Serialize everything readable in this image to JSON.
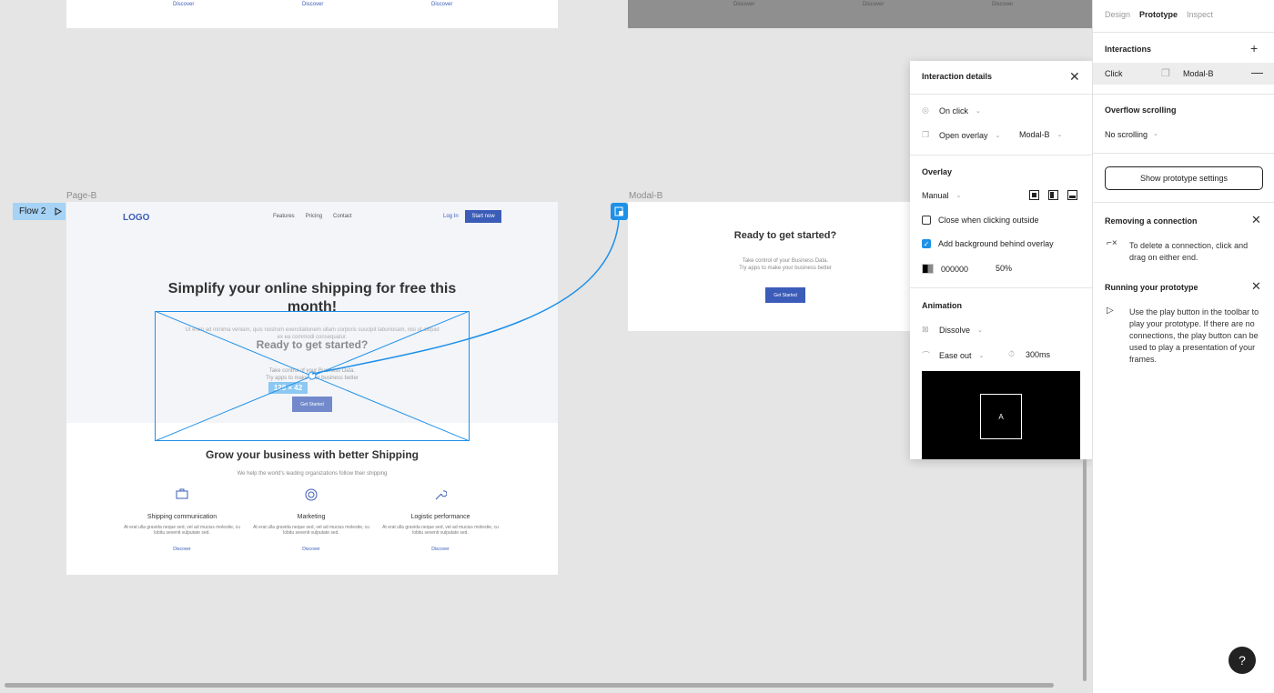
{
  "canvas": {
    "top_frames": {
      "left_discover": [
        "Discover",
        "Discover",
        "Discover"
      ],
      "right_discover": [
        "Discover",
        "Discover",
        "Discover"
      ]
    },
    "flow_tag": "Flow 2",
    "page_label": "Page-B",
    "modal_label": "Modal-B",
    "page": {
      "logo": "LOGO",
      "nav": [
        "Features",
        "Pricing",
        "Contact"
      ],
      "login": "Log In",
      "start_now": "Start now",
      "hero_title": "Simplify your online shipping for free this month!",
      "hero_sub": "Ut enim ad minima veniam, quis nostrum exercitationem ullam corporis suscipit laboriosam, nisi ut aliquid ex ea commodi consequatur.",
      "grow_title": "Grow your business with better Shipping",
      "grow_sub": "We help the world's leading organizations follow their shipping",
      "features": [
        {
          "icon": "briefcase-icon",
          "title": "Shipping communication",
          "desc": "At erat ulla gravida neque sed, vel ad mucius molestie, cu lobitu sevenit vulputate sed.",
          "link": "Discover"
        },
        {
          "icon": "lifebuoy-icon",
          "title": "Marketing",
          "desc": "At erat ulla gravida neque sed, vel ad mucius molestie, cu lobitu sevenit vulputate sed.",
          "link": "Discover"
        },
        {
          "icon": "wrench-icon",
          "title": "Logistic performance",
          "desc": "At erat ulla gravida neque sed, vel ad mucius molestie, cu lobitu sevenit vulputate sed.",
          "link": "Discover"
        }
      ]
    },
    "overlay_preview": {
      "title": "Ready to get started?",
      "sub_line1": "Take control of your Business Data.",
      "sub_line2": "Try apps to make your business better",
      "button": "Get Started",
      "size_badge": "128 × 42"
    },
    "modal": {
      "title": "Ready to get started?",
      "sub_line1": "Take control of your Business Data.",
      "sub_line2": "Try apps to make your business better",
      "button": "Get Started"
    }
  },
  "interaction_details": {
    "title": "Interaction details",
    "trigger": "On click",
    "action": "Open overlay",
    "destination": "Modal-B",
    "overlay_heading": "Overlay",
    "position": "Manual",
    "close_outside_label": "Close when clicking outside",
    "close_outside_checked": false,
    "add_bg_label": "Add background behind overlay",
    "add_bg_checked": true,
    "bg_color": "000000",
    "bg_opacity": "50%",
    "animation_heading": "Animation",
    "animation": "Dissolve",
    "easing": "Ease out",
    "duration": "300ms",
    "preview_letter": "A"
  },
  "panel": {
    "tabs": [
      "Design",
      "Prototype",
      "Inspect"
    ],
    "active_tab": "Prototype",
    "interactions_heading": "Interactions",
    "interaction_trigger": "Click",
    "interaction_target": "Modal-B",
    "overflow_heading": "Overflow scrolling",
    "overflow_value": "No scrolling",
    "show_settings": "Show prototype settings",
    "tips": [
      {
        "title": "Removing a connection",
        "body": "To delete a connection, click and drag on either end."
      },
      {
        "title": "Running your prototype",
        "body": "Use the play button in the toolbar to play your prototype. If there are no connections, the play button can be used to play a presentation of your frames."
      }
    ],
    "help": "?"
  },
  "colors": {
    "accent": "#1e90e8",
    "brand": "#3b5cb8",
    "canvas": "#e5e5e5"
  }
}
